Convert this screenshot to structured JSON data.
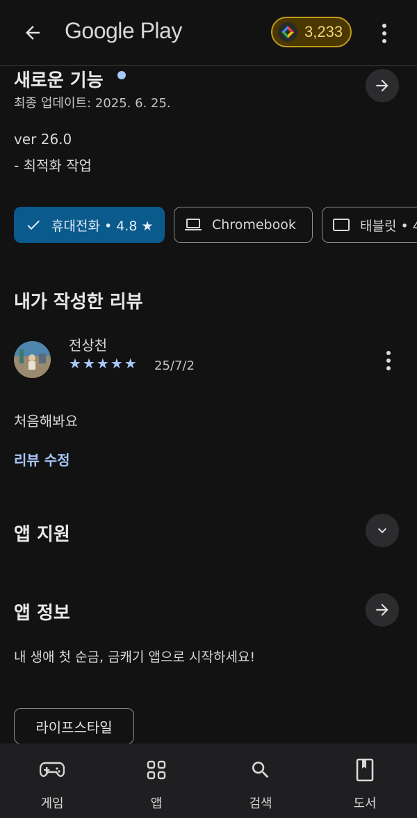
{
  "header": {
    "title": "Google Play",
    "points": "3,233"
  },
  "whats_new": {
    "title": "새로운 기능",
    "updated": "최종 업데이트: 2025. 6. 25.",
    "version": "ver 26.0",
    "note": "- 최적화 작업"
  },
  "devices": [
    {
      "label": "휴대전화 • 4.8 ★",
      "icon": "check-icon",
      "selected": true
    },
    {
      "label": "Chromebook",
      "icon": "laptop-icon",
      "selected": false
    },
    {
      "label": "태블릿 • 4",
      "icon": "tablet-icon",
      "selected": false
    }
  ],
  "my_review": {
    "title": "내가 작성한 리뷰",
    "author": "전상천",
    "rating": 5,
    "date": "25/7/2",
    "text": "처음해봐요",
    "edit_label": "리뷰 수정"
  },
  "app_support": {
    "title": "앱 지원"
  },
  "app_info": {
    "title": "앱 정보",
    "description": "내 생애 첫 순금, 금캐기 앱으로 시작하세요!",
    "tag": "라이프스타일"
  },
  "bottom_nav": [
    {
      "label": "게임",
      "icon": "gamepad-icon"
    },
    {
      "label": "앱",
      "icon": "apps-grid-icon"
    },
    {
      "label": "검색",
      "icon": "search-icon"
    },
    {
      "label": "도서",
      "icon": "book-icon"
    }
  ],
  "colors": {
    "accent": "#a8c7fa",
    "chip_selected": "#0b5a8c",
    "points_border": "#c39a1a"
  }
}
